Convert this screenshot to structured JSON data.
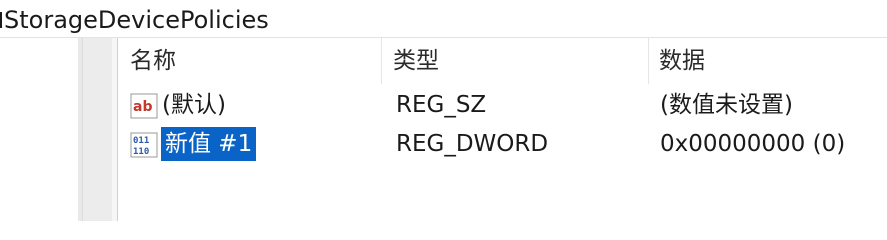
{
  "address": {
    "path_text": "StorageDevicePolicies"
  },
  "columns": {
    "name": "名称",
    "type": "类型",
    "data": "数据"
  },
  "values": [
    {
      "icon": "string-value-icon",
      "name": "(默认)",
      "type": "REG_SZ",
      "data": "(数值未设置)"
    },
    {
      "icon": "binary-dword-value-icon",
      "name": "新值 #1",
      "type": "REG_DWORD",
      "data": "0x00000000 (0)",
      "editing": true
    }
  ],
  "colors": {
    "selection": "#0a64c8",
    "string_icon_red": "#c0392b",
    "dword_icon_blue": "#2b5aa8"
  }
}
